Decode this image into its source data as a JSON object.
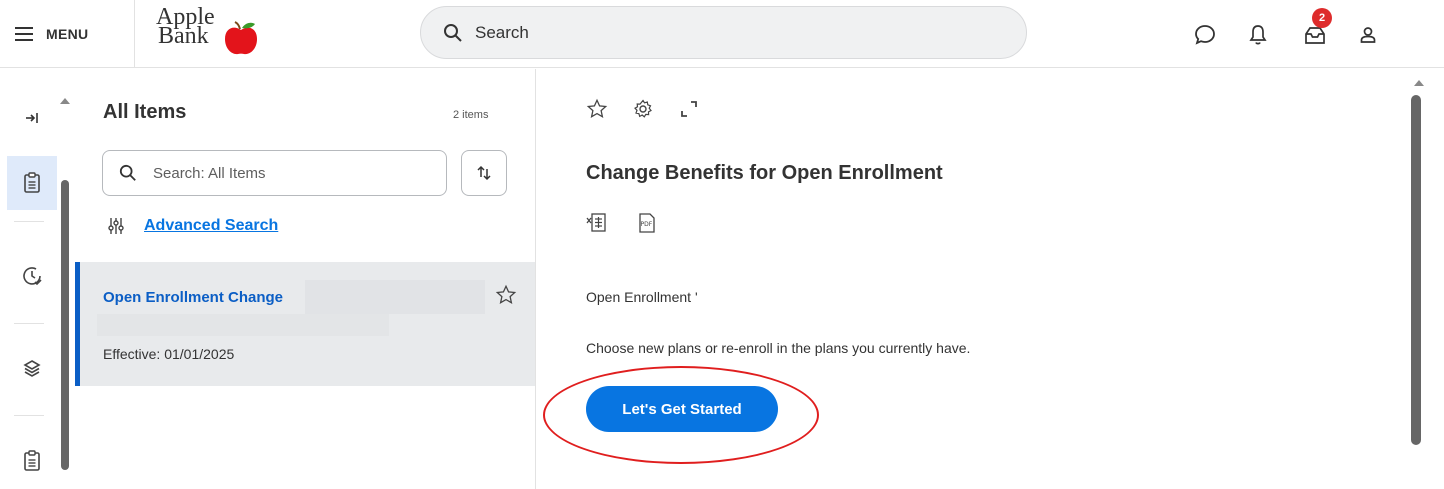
{
  "header": {
    "menu_label": "MENU",
    "logo_line1": "Apple",
    "logo_line2": "Bank",
    "search_placeholder": "Search",
    "inbox_badge": "2",
    "icons": [
      "menu-icon",
      "search-icon",
      "chat-icon",
      "bell-icon",
      "inbox-icon",
      "user-icon"
    ]
  },
  "rail": {
    "icons": [
      "expand-icon",
      "clipboard-icon",
      "clock-icon",
      "layers-icon",
      "clipboard-icon"
    ]
  },
  "list": {
    "title": "All Items",
    "count": "2 items",
    "search_placeholder": "Search: All Items",
    "advanced_search": "Advanced Search",
    "items": [
      {
        "title": "Open Enrollment Change",
        "effective": "Effective: 01/01/2025"
      }
    ]
  },
  "detail": {
    "title": "Change Benefits for Open Enrollment",
    "subtitle": "Open Enrollment '",
    "description": "Choose new plans or re-enroll in the plans you currently have.",
    "cta_label": "Let's Get Started"
  },
  "colors": {
    "accent": "#0875e1",
    "link": "#0b5ec5",
    "badge": "#de2c2c",
    "annotation": "#e01e1e",
    "selected_bg": "#e8eaec"
  }
}
